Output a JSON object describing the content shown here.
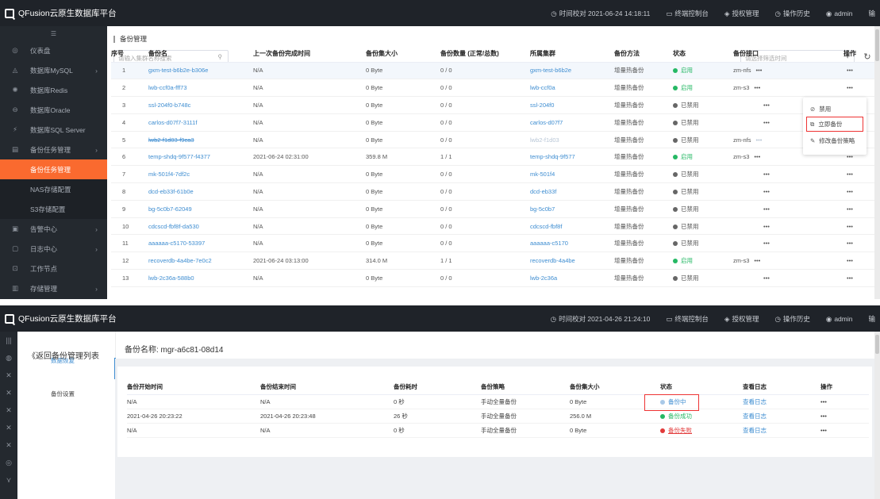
{
  "screen1": {
    "logo_text": "QFusion云原生数据库平台",
    "topbar": {
      "time_sync": "时间校对 2021-06-24 14:18:11",
      "terminal": "终端控制台",
      "license": "授权管理",
      "history": "操作历史",
      "user": "admin",
      "extra": "输"
    },
    "sidebar": {
      "items": [
        {
          "icon": "dashboard-icon",
          "glyph": "◎",
          "label": "仪表盘"
        },
        {
          "icon": "mysql-icon",
          "glyph": "◬",
          "label": "数据库MySQL",
          "chevron": true
        },
        {
          "icon": "redis-icon",
          "glyph": "✺",
          "label": "数据库Redis"
        },
        {
          "icon": "oracle-icon",
          "glyph": "⊖",
          "label": "数据库Oracle"
        },
        {
          "icon": "sqlserver-icon",
          "glyph": "⚡",
          "label": "数据库SQL Server"
        },
        {
          "icon": "backup-task-icon",
          "glyph": "▤",
          "label": "备份任务管理",
          "chevron": true
        }
      ],
      "sub_items": [
        "备份任务管理",
        "NAS存储配置",
        "S3存储配置"
      ],
      "bottom_items": [
        {
          "icon": "alert-icon",
          "glyph": "▣",
          "label": "告警中心",
          "chevron": true
        },
        {
          "icon": "log-icon",
          "glyph": "▢",
          "label": "日志中心",
          "chevron": true
        },
        {
          "icon": "node-icon",
          "glyph": "⊡",
          "label": "工作节点"
        },
        {
          "icon": "storage-icon",
          "glyph": "▥",
          "label": "存储管理",
          "chevron": true
        }
      ]
    },
    "breadcrumb": "备份管理",
    "search_placeholder": "请输入集群名称搜索",
    "time_placeholder": "请选择筛选时间",
    "table": {
      "headers": [
        "序号",
        "备份名",
        "上一次备份完成时间",
        "备份集大小",
        "备份数量 (正常/总数)",
        "所属集群",
        "备份方法",
        "状态",
        "备份接口",
        "操作"
      ],
      "rows": [
        {
          "no": "1",
          "name": "gxm-test-b6b2e-b306e",
          "last": "N/A",
          "size": "0 Byte",
          "count": "0 / 0",
          "cluster": "gxm-test-b6b2e",
          "method": "增量热备份",
          "status": "启用",
          "status_type": "on",
          "iface": "zm-nfs",
          "ops": "•••",
          "hi": true
        },
        {
          "no": "2",
          "name": "lwb-ccf0a-fff73",
          "last": "N/A",
          "size": "0 Byte",
          "count": "0 / 0",
          "cluster": "lwb-ccf0a",
          "method": "增量热备份",
          "status": "启用",
          "status_type": "on",
          "iface": "zm-s3",
          "ops": "•••"
        },
        {
          "no": "3",
          "name": "ssl-204f0-b748c",
          "last": "N/A",
          "size": "0 Byte",
          "count": "0 / 0",
          "cluster": "ssl-204f0",
          "method": "增量热备份",
          "status": "已禁用",
          "status_type": "off",
          "iface": "",
          "ops": "•••"
        },
        {
          "no": "4",
          "name": "carlos-d07f7-3111f",
          "last": "N/A",
          "size": "0 Byte",
          "count": "0 / 0",
          "cluster": "carlos-d07f7",
          "method": "增量热备份",
          "status": "已禁用",
          "status_type": "off",
          "iface": "",
          "ops": "•••"
        },
        {
          "no": "5",
          "name": "lwb2-f1d03-f9ca3",
          "last": "N/A",
          "size": "0 Byte",
          "count": "0 / 0",
          "cluster": "lwb2-f1d03",
          "method": "增量热备份",
          "status": "已禁用",
          "status_type": "off",
          "iface": "zm-nfs",
          "ops": "•••",
          "strike": true
        },
        {
          "no": "6",
          "name": "temp-shdq-9f577-f4377",
          "last": "2021-06-24 02:31:00",
          "size": "359.8 M",
          "count": "1 / 1",
          "cluster": "temp-shdq-9f577",
          "method": "增量热备份",
          "status": "启用",
          "status_type": "on",
          "iface": "zm-s3",
          "ops": "•••"
        },
        {
          "no": "7",
          "name": "mk-501f4-7df2c",
          "last": "N/A",
          "size": "0 Byte",
          "count": "0 / 0",
          "cluster": "mk-501f4",
          "method": "增量热备份",
          "status": "已禁用",
          "status_type": "off",
          "iface": "",
          "ops": "•••"
        },
        {
          "no": "8",
          "name": "dcd-eb33f-61b0e",
          "last": "N/A",
          "size": "0 Byte",
          "count": "0 / 0",
          "cluster": "dcd-eb33f",
          "method": "增量热备份",
          "status": "已禁用",
          "status_type": "off",
          "iface": "",
          "ops": "•••"
        },
        {
          "no": "9",
          "name": "bg-5c0b7-62049",
          "last": "N/A",
          "size": "0 Byte",
          "count": "0 / 0",
          "cluster": "bg-5c0b7",
          "method": "增量热备份",
          "status": "已禁用",
          "status_type": "off",
          "iface": "",
          "ops": "•••"
        },
        {
          "no": "10",
          "name": "cdcscd-fbf8f-da530",
          "last": "N/A",
          "size": "0 Byte",
          "count": "0 / 0",
          "cluster": "cdcscd-fbf8f",
          "method": "增量热备份",
          "status": "已禁用",
          "status_type": "off",
          "iface": "",
          "ops": "•••"
        },
        {
          "no": "11",
          "name": "aaaaaa-c5170-53397",
          "last": "N/A",
          "size": "0 Byte",
          "count": "0 / 0",
          "cluster": "aaaaaa-c5170",
          "method": "增量热备份",
          "status": "已禁用",
          "status_type": "off",
          "iface": "",
          "ops": "•••"
        },
        {
          "no": "12",
          "name": "recoverdb-4a4be-7e0c2",
          "last": "2021-06-24 03:13:00",
          "size": "314.0 M",
          "count": "1 / 1",
          "cluster": "recoverdb-4a4be",
          "method": "增量热备份",
          "status": "启用",
          "status_type": "on",
          "iface": "zm-s3",
          "ops": "•••"
        },
        {
          "no": "13",
          "name": "lwb-2c36a-588b0",
          "last": "N/A",
          "size": "0 Byte",
          "count": "0 / 0",
          "cluster": "lwb-2c36a",
          "method": "增量热备份",
          "status": "已禁用",
          "status_type": "off",
          "iface": "",
          "ops": "•••"
        }
      ]
    },
    "popup": {
      "disable": "禁用",
      "backup_now": "立即备份",
      "edit_policy": "修改备份策略"
    }
  },
  "screen2": {
    "logo_text": "QFusion云原生数据库平台",
    "topbar": {
      "time_sync": "时间校对 2021-04-26 21:24:10",
      "terminal": "终端控制台",
      "license": "授权管理",
      "history": "操作历史",
      "user": "admin",
      "extra": "输"
    },
    "back_link": "《返回备份管理列表",
    "nav": {
      "restore": "数据恢复",
      "settings": "备份设置"
    },
    "backup_name": "备份名称: mgr-a6c81-08d14",
    "table": {
      "headers": [
        "备份开始时间",
        "备份结束时间",
        "备份耗时",
        "备份策略",
        "备份集大小",
        "状态",
        "查看日志",
        "操作"
      ],
      "rows": [
        {
          "start": "N/A",
          "end": "N/A",
          "dur": "0 秒",
          "policy": "手动全量备份",
          "size": "0 Byte",
          "status": "备份中",
          "status_type": "running",
          "log": "查看日志",
          "ops": "•••"
        },
        {
          "start": "2021-04-26 20:23:22",
          "end": "2021-04-26 20:23:48",
          "dur": "26 秒",
          "policy": "手动全量备份",
          "size": "256.0 M",
          "status": "备份成功",
          "status_type": "success",
          "log": "查看日志",
          "ops": "•••"
        },
        {
          "start": "N/A",
          "end": "N/A",
          "dur": "0 秒",
          "policy": "手动全量备份",
          "size": "0 Byte",
          "status": "备份失败",
          "status_type": "failed",
          "log": "查看日志",
          "ops": "•••"
        }
      ]
    }
  }
}
